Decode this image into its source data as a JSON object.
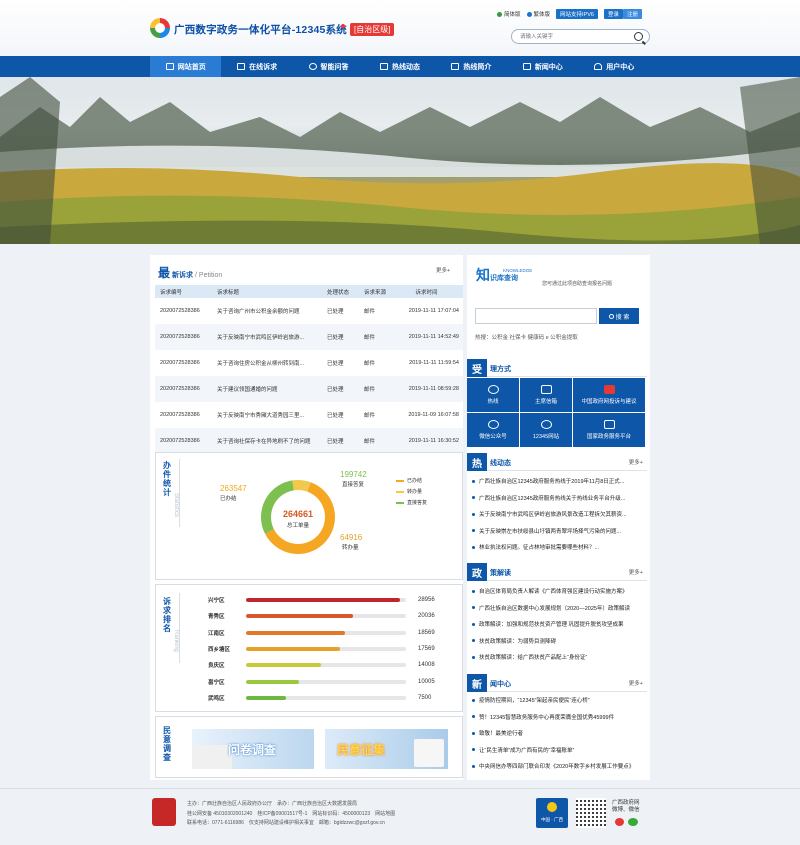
{
  "header": {
    "site_title": "广西数字政务一体化平台-12345系统",
    "region": "[自治区级]",
    "topnav": [
      {
        "label": "简体版"
      },
      {
        "label": "繁体版"
      }
    ],
    "ipv6_label": "网站支持IPV6",
    "login_label": "登录",
    "register_label": "注册",
    "search_placeholder": "请输入关键字"
  },
  "nav": [
    {
      "label": "网站首页",
      "active": true
    },
    {
      "label": "在线诉求"
    },
    {
      "label": "智能问答"
    },
    {
      "label": "热线动态"
    },
    {
      "label": "热线简介"
    },
    {
      "label": "新闻中心"
    },
    {
      "label": "用户中心"
    }
  ],
  "petition": {
    "big_char": "最",
    "title": "新诉求",
    "sub": "/ Petition",
    "more": "更多+",
    "columns": [
      "诉求编号",
      "诉求标题",
      "处理状态",
      "诉求来源",
      "诉求时间"
    ],
    "rows": [
      [
        "2020072528386",
        "关于咨询广州市公积金余额的问题",
        "已处理",
        "邮件",
        "2019-11-11 17:07:04"
      ],
      [
        "2020072528386",
        "关于反映南宁市武鸣区伊岭岩旅游...",
        "已处理",
        "邮件",
        "2019-11-11 14:52:49"
      ],
      [
        "2020072528386",
        "关于咨询住房公积金从柳州转到南...",
        "已处理",
        "邮件",
        "2019-11-11 11:59:54"
      ],
      [
        "2020072528386",
        "关于建议领国通婚的问题",
        "已处理",
        "邮件",
        "2019-11-11 08:59:28"
      ],
      [
        "2020072528386",
        "关于反映南宁市秀厢大道秀园三里...",
        "已处理",
        "邮件",
        "2019-11-09 16:07:58"
      ],
      [
        "2020072528386",
        "关于咨询社保存卡在异地刷不了的问题",
        "已处理",
        "邮件",
        "2019-11-11 16:30:52"
      ]
    ]
  },
  "stats": {
    "title_chars": [
      "办",
      "件",
      "统",
      "计"
    ],
    "subtitle": "Statistics",
    "total_value": "264661",
    "total_label": "总工单量",
    "done_value": "263547",
    "done_label": "已办结",
    "direct_value": "199742",
    "direct_label": "直接答复",
    "transfer_value": "64916",
    "transfer_label": "转办量",
    "legend": [
      "已办结",
      "转办量",
      "直接答复"
    ],
    "colors": {
      "done": "#f5a623",
      "direct": "#7dc04f",
      "transfer": "#f2c94c"
    },
    "segments": [
      {
        "name": "已办结",
        "fraction": 0.62,
        "color": "#f5a623"
      },
      {
        "name": "直接答复",
        "fraction": 0.3,
        "color": "#7dc04f"
      },
      {
        "name": "转办量",
        "fraction": 0.08,
        "color": "#f2c94c"
      }
    ]
  },
  "ranking": {
    "title_chars": [
      "诉",
      "求",
      "排",
      "名"
    ],
    "subtitle": "Ranking",
    "max": 30000,
    "items": [
      {
        "name": "兴宁区",
        "value": 28956,
        "color": "#c0272d"
      },
      {
        "name": "青秀区",
        "value": 20036,
        "color": "#d9552b"
      },
      {
        "name": "江南区",
        "value": 18569,
        "color": "#e07a2a"
      },
      {
        "name": "西乡塘区",
        "value": 17569,
        "color": "#e5a12a"
      },
      {
        "name": "良庆区",
        "value": 14008,
        "color": "#c5c93a"
      },
      {
        "name": "邕宁区",
        "value": 10005,
        "color": "#9ac83e"
      },
      {
        "name": "武鸣区",
        "value": 7500,
        "color": "#6db842"
      }
    ]
  },
  "opinion": {
    "title_chars": [
      "民",
      "意",
      "调",
      "查"
    ],
    "survey_label": "问卷调查",
    "collect_label": "民意征集"
  },
  "knowledge": {
    "logo_char": "知",
    "logo_text": "识库查询",
    "logo_en": "KNOWLEDGE",
    "desc": "您可通过此项自助查询报名问题",
    "search_label": "搜 索",
    "hot_label": "热搜：",
    "hot_items": "公积金 社保卡 健康码 e 公积金提取"
  },
  "contact": {
    "box_char": "受",
    "title": "理方式",
    "items": [
      {
        "label": "热线"
      },
      {
        "label": "主席信箱"
      },
      {
        "label": "中国政府网投诉与建议"
      },
      {
        "label": "微信公众号"
      },
      {
        "label": "12345网站"
      },
      {
        "label": "国家政务服务平台"
      }
    ]
  },
  "hotline": {
    "box_char": "热",
    "title": "线动态",
    "more": "更多+",
    "items": [
      "广西壮族自治区12345政府服务热线于2019年11月8日正式...",
      "广西壮族自治区12345政府服务热线关于热线业务平台升级...",
      "关于反映南宁市武鸣区伊岭岩旅游风景改造工程拆欠其薪资...",
      "关于反映崇左市扶绥县山圩镇两青翠坪场择气污染的问题...",
      "林业执法权问题。征占林地审批需要哪些材料？..."
    ]
  },
  "policy": {
    "box_char": "政",
    "title": "策解读",
    "more": "更多+",
    "items": [
      "自治区体育局负责人解读《广西体育强区建设行动实施方案》",
      "广西壮族自治区数据中心发展规划（2020—2025年）政策解读",
      "政策解读：加强和规范扶贫资产管理 巩固提升脱贫攻坚成果",
      "扶贫政策解读：为弱势目测降碍",
      "扶贫政策解读：给广西扶贫产品配上“身份证”"
    ]
  },
  "news": {
    "box_char": "新",
    "title": "闻中心",
    "more": "更多+",
    "items": [
      "疫情防控期间，“12345”架起亲民便民“连心桥”",
      "赞！12345智慧政务服务中心再度荣膺全国优秀45999件",
      "致敬！最美逆行者",
      "让“民生清单”成为广西有民的“幸福账单”",
      "中央网信办等四部门联合印发《2020年数字乡村发展工作要点》"
    ]
  },
  "footer": {
    "line1": "主办：广西壮族自治区人民政府办公厅　承办：广西壮族自治区大数据发展局",
    "line2": "桂公网安备 45010302001240　桂ICP备09001517号-1　网站标识码：4500000123　网站地图",
    "line3": "联系电话：0771-6116986　仅支持网站建设维护相关事宜　邮箱：bgtdzzwc@gxzf.gov.cn",
    "gov_line1": "广西政府网",
    "gov_line2": "微博、微信",
    "gov_badge_text": "中国 · 广西"
  }
}
